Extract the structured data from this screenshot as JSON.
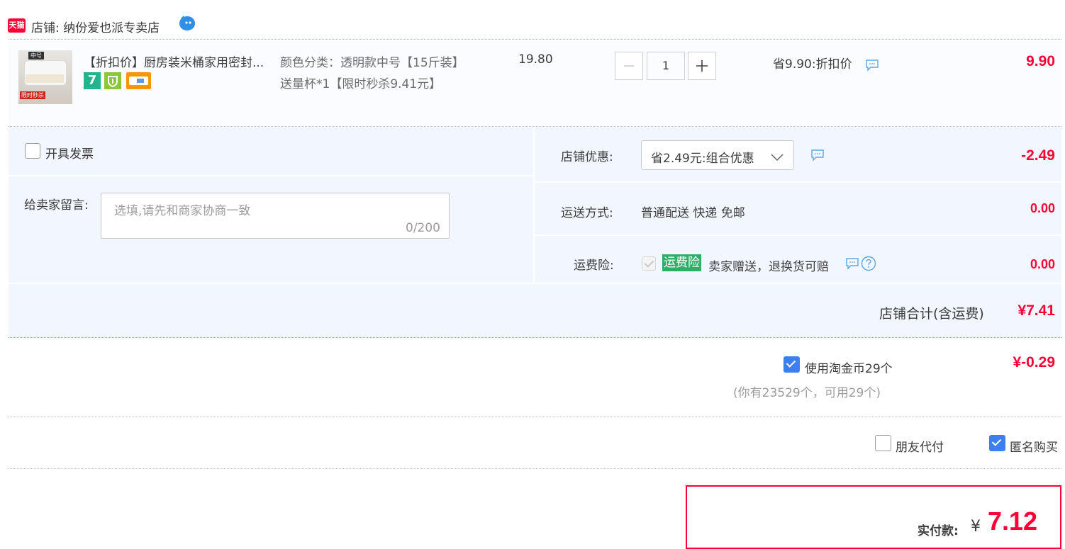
{
  "shop": {
    "badge": "天猫",
    "label": "店铺: ",
    "name": "纳份爱也派专卖店"
  },
  "item": {
    "title": "【折扣价】厨房装米桶家用密封...",
    "badge_seven": "7",
    "image_tag_top": "中号",
    "image_tag_bottom": "限时秒杀",
    "spec": "颜色分类：透明款中号【15斤装】送量杯*1【限时秒杀9.41元】",
    "unit_price": "19.80",
    "quantity": "1",
    "discount": "省9.90:折扣价",
    "subtotal": "9.90"
  },
  "invoice": {
    "label": "开具发票"
  },
  "message": {
    "label": "给卖家留言:",
    "placeholder": "选填,请先和商家协商一致",
    "counter": "0/200"
  },
  "shop_discount": {
    "label": "店铺优惠:",
    "selected": "省2.49元:组合优惠",
    "amount": "-2.49"
  },
  "shipping": {
    "label": "运送方式:",
    "value": "普通配送 快递 免邮",
    "amount": "0.00"
  },
  "insurance": {
    "label": "运费险:",
    "tag": "运费险",
    "text": "卖家赠送，退换货可赔",
    "amount": "0.00"
  },
  "shop_total": {
    "label": "店铺合计(含运费)",
    "amount": "¥7.41"
  },
  "coins": {
    "label": "使用淘金币29个",
    "note": "(你有23529个，可用29个)",
    "amount": "¥-0.29"
  },
  "options": {
    "friend_pay": "朋友代付",
    "anonymous": "匿名购买"
  },
  "pay": {
    "label": "实付款:",
    "currency": "¥",
    "amount": "7.12"
  },
  "colors": {
    "accent_red": "#ff0036",
    "blue_check": "#3d7ff0",
    "panel_bg": "#f2f7ff",
    "tag_green": "#2fae68"
  }
}
